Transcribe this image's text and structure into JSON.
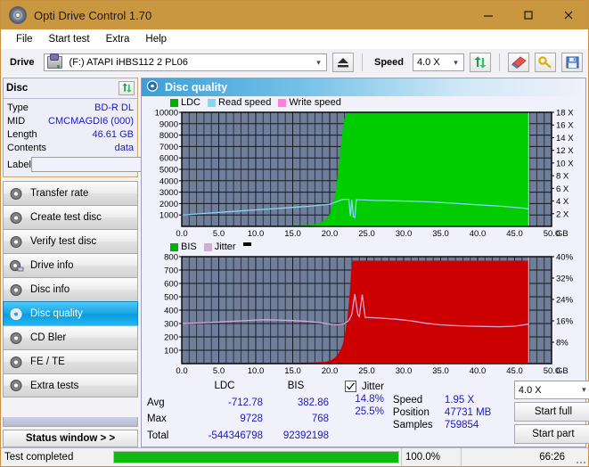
{
  "window": {
    "title": "Opti Drive Control 1.70",
    "app_icon": "disc-icon",
    "minimize": "–",
    "maximize": "□",
    "close": "✕"
  },
  "menu": {
    "items": [
      "File",
      "Start test",
      "Extra",
      "Help"
    ]
  },
  "toolbar": {
    "drive_label": "Drive",
    "drive_value": "(F:)  ATAPI iHBS112  2 PL06",
    "eject_icon": "eject-icon",
    "speed_label": "Speed",
    "speed_value": "4.0 X",
    "refresh_icon": "refresh-icon",
    "eraser_icon": "eraser-icon",
    "key_icon": "key-icon",
    "save_icon": "save-icon"
  },
  "disc_panel": {
    "header": "Disc",
    "refresh_icon": "refresh-icon",
    "rows": [
      {
        "key": "Type",
        "value": "BD-R DL"
      },
      {
        "key": "MID",
        "value": "CMCMAGDI6 (000)"
      },
      {
        "key": "Length",
        "value": "46.61 GB"
      },
      {
        "key": "Contents",
        "value": "data"
      }
    ],
    "label_key": "Label",
    "label_value": "",
    "label_placeholder": "",
    "disc_icon": "disc-icon"
  },
  "nav": {
    "items": [
      {
        "label": "Transfer rate",
        "icon": "disc-icon",
        "selected": false
      },
      {
        "label": "Create test disc",
        "icon": "disc-icon",
        "selected": false
      },
      {
        "label": "Verify test disc",
        "icon": "disc-icon",
        "selected": false
      },
      {
        "label": "Drive info",
        "icon": "disc-icon",
        "selected": false
      },
      {
        "label": "Disc info",
        "icon": "disc-icon",
        "selected": false
      },
      {
        "label": "Disc quality",
        "icon": "disc-icon",
        "selected": true
      },
      {
        "label": "CD Bler",
        "icon": "disc-icon",
        "selected": false
      },
      {
        "label": "FE / TE",
        "icon": "disc-icon",
        "selected": false
      },
      {
        "label": "Extra tests",
        "icon": "disc-icon",
        "selected": false
      }
    ],
    "status_window_button": "Status window > >"
  },
  "main": {
    "header_title": "Disc quality",
    "header_icon": "disc-icon"
  },
  "stats": {
    "col_headers": [
      "LDC",
      "BIS"
    ],
    "row_labels": [
      "Avg",
      "Max",
      "Total"
    ],
    "ldc": {
      "avg": "-712.78",
      "max": "9728",
      "total": "-544346798"
    },
    "bis": {
      "avg": "382.86",
      "max": "768",
      "total": "92392198"
    },
    "jitter": {
      "label": "Jitter",
      "checked": true,
      "avg": "14.8%",
      "max": "25.5%"
    },
    "speed_label": "Speed",
    "speed_value": "1.95 X",
    "position_label": "Position",
    "position_value": "47731 MB",
    "samples_label": "Samples",
    "samples_value": "759854",
    "speed_select": "4.0 X",
    "start_full": "Start full",
    "start_part": "Start part"
  },
  "statusbar": {
    "text": "Test completed",
    "progress_pct": "100.0%",
    "progress_value": 100,
    "elapsed": "66:26"
  },
  "chart_data": [
    {
      "id": "top",
      "type": "area",
      "title": "Disc quality",
      "xlabel": "GB",
      "ylabel": "LDC",
      "y2label": "X",
      "xlim": [
        0,
        50
      ],
      "ylim": [
        0,
        10000
      ],
      "y2lim": [
        0,
        18
      ],
      "grid": true,
      "legend_position": "top-left",
      "x_ticks": [
        "0.0",
        "5.0",
        "10.0",
        "15.0",
        "20.0",
        "25.0",
        "30.0",
        "35.0",
        "40.0",
        "45.0",
        "50.0"
      ],
      "x_unit": "GB",
      "y_ticks": [
        "1000",
        "2000",
        "3000",
        "4000",
        "5000",
        "6000",
        "7000",
        "8000",
        "9000",
        "10000"
      ],
      "y2_ticks": [
        "2 X",
        "4 X",
        "6 X",
        "8 X",
        "10 X",
        "12 X",
        "14 X",
        "16 X",
        "18 X"
      ],
      "legend": [
        {
          "name": "LDC",
          "color": "#00b000"
        },
        {
          "name": "Read speed",
          "color": "#86d6f2"
        },
        {
          "name": "Write speed",
          "color": "#ff7fe0"
        }
      ],
      "data_end_gb": 46.9,
      "series": [
        {
          "name": "LDC",
          "color": "#00cc00",
          "type": "area",
          "x": [
            0.0,
            2.0,
            4.0,
            6.0,
            8.0,
            10.0,
            12.0,
            14.0,
            16.0,
            17.5,
            18.5,
            19.3,
            20.0,
            20.4,
            20.8,
            21.1,
            21.4,
            21.7,
            22.0,
            22.4,
            23.0,
            25.0,
            30.0,
            35.0,
            40.0,
            44.0,
            46.9
          ],
          "values": [
            60,
            55,
            58,
            62,
            65,
            70,
            72,
            75,
            95,
            140,
            260,
            520,
            1050,
            1900,
            3100,
            4600,
            6400,
            8200,
            9500,
            9900,
            10000,
            10000,
            10000,
            10000,
            10000,
            10000,
            10000
          ]
        },
        {
          "name": "Read speed",
          "color": "#86d6f2",
          "type": "line",
          "x": [
            0.0,
            2.5,
            5.0,
            7.5,
            10.0,
            12.5,
            15.0,
            17.5,
            20.0,
            21.0,
            21.6,
            22.0,
            22.6,
            22.8,
            23.0,
            23.2,
            23.4,
            23.6,
            24.0,
            26.0,
            28.0,
            30.0,
            33.0,
            36.0,
            40.0,
            43.0,
            46.0,
            46.9
          ],
          "values_x": [
            1.78,
            2.0,
            2.2,
            2.4,
            2.6,
            2.8,
            3.0,
            3.2,
            3.5,
            3.9,
            4.2,
            4.25,
            4.25,
            1.6,
            4.2,
            1.5,
            1.4,
            4.2,
            4.2,
            4.1,
            4.05,
            4.0,
            3.9,
            3.7,
            3.4,
            3.2,
            2.9,
            2.75
          ]
        }
      ]
    },
    {
      "id": "bottom",
      "type": "area",
      "xlabel": "GB",
      "ylabel": "BIS",
      "y2label": "%",
      "xlim": [
        0,
        50
      ],
      "ylim": [
        0,
        800
      ],
      "y2lim": [
        0,
        40
      ],
      "grid": true,
      "legend_position": "top-left",
      "x_ticks": [
        "0.0",
        "5.0",
        "10.0",
        "15.0",
        "20.0",
        "25.0",
        "30.0",
        "35.0",
        "40.0",
        "45.0",
        "50.0"
      ],
      "x_unit": "GB",
      "y_ticks": [
        "100",
        "200",
        "300",
        "400",
        "500",
        "600",
        "700",
        "800"
      ],
      "y2_ticks": [
        "8%",
        "16%",
        "24%",
        "32%",
        "40%"
      ],
      "legend": [
        {
          "name": "BIS",
          "color": "#00b000"
        },
        {
          "name": "Jitter",
          "color": "#d8a8d8"
        }
      ],
      "data_end_gb": 46.9,
      "series": [
        {
          "name": "BIS",
          "color": "#cc0000",
          "type": "area",
          "x": [
            0.0,
            5.0,
            10.0,
            15.0,
            18.0,
            19.5,
            20.2,
            20.6,
            21.0,
            21.4,
            21.8,
            22.1,
            22.4,
            22.7,
            22.9,
            23.1,
            24.0,
            30.0,
            38.0,
            44.0,
            46.9
          ],
          "values": [
            4,
            5,
            6,
            6,
            8,
            14,
            26,
            40,
            62,
            96,
            150,
            230,
            340,
            520,
            690,
            770,
            770,
            770,
            770,
            770,
            770
          ]
        },
        {
          "name": "Jitter",
          "color": "#d8a8d8",
          "type": "line",
          "x": [
            0.0,
            2.0,
            4.0,
            6.0,
            8.0,
            10.0,
            11.5,
            13.0,
            15.0,
            17.0,
            18.5,
            20.0,
            21.0,
            22.0,
            22.6,
            23.0,
            23.4,
            23.8,
            24.0,
            24.4,
            24.8,
            25.5,
            27.0,
            29.0,
            31.0,
            33.0,
            35.0,
            37.0,
            39.0,
            41.0,
            43.0,
            45.0,
            46.5,
            46.9
          ],
          "values_pct": [
            15.0,
            15.2,
            15.4,
            15.7,
            16.0,
            16.3,
            16.4,
            16.3,
            16.1,
            15.8,
            15.4,
            14.8,
            14.5,
            14.9,
            16.2,
            18.5,
            26.0,
            18.4,
            17.6,
            25.8,
            17.3,
            17.2,
            17.0,
            16.6,
            16.0,
            15.1,
            14.5,
            14.2,
            14.0,
            13.9,
            13.8,
            14.0,
            14.6,
            14.8
          ]
        }
      ]
    }
  ]
}
